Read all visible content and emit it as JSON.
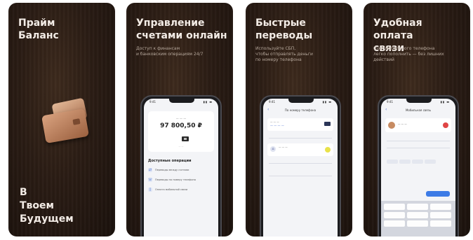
{
  "cards": [
    {
      "title": "Прайм\nБаланс",
      "bottom_title": "В\nТвоем\nБудущем",
      "icon": "wallet-icon"
    },
    {
      "title": "Управление\nсчетами онлайн",
      "subtitle": "Доступ к финансам\nи банковским операциям 24/7",
      "phone": {
        "time": "9:41",
        "balance_amount": "97 800,50 ₽",
        "ops_heading": "Доступные операции",
        "ops": [
          "Переводы между счетами",
          "Переводы по номеру телефона",
          "Оплата мобильной связи"
        ]
      }
    },
    {
      "title": "Быстрые\nпереводы",
      "subtitle": "Используйте СБП,\nчтобы отправлять деньги\nпо номеру телефона",
      "phone": {
        "time": "9:41",
        "nav_title": "По номеру телефона"
      }
    },
    {
      "title": "Удобная оплата\nсвязи",
      "subtitle": "Счет мобильного телефона\nлегко пополнить — без лишних\nдействий",
      "phone": {
        "time": "9:41",
        "nav_title": "Мобильная связь"
      }
    }
  ],
  "colors": {
    "card_bg": "#2a1c14",
    "accent_blue": "#3d7be6",
    "wallet_copper": "#c98f6c"
  }
}
